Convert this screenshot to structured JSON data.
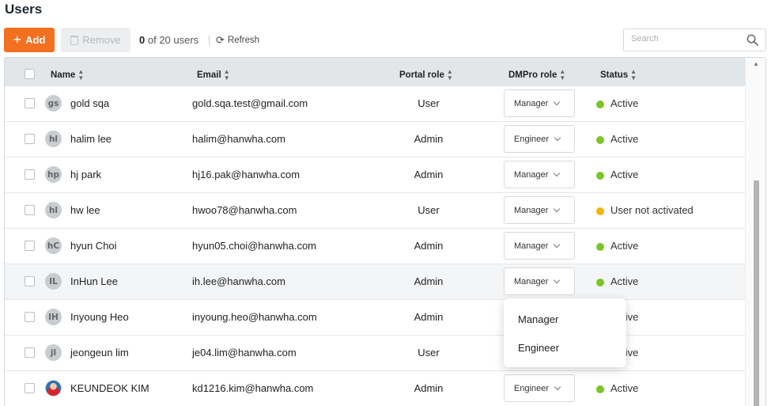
{
  "page": {
    "title": "Users"
  },
  "toolbar": {
    "add_label": "Add",
    "remove_label": "Remove",
    "count_selected": "0",
    "count_rest": "of 20 users",
    "refresh_label": "Refresh",
    "search_placeholder": "Search"
  },
  "table": {
    "headers": {
      "name": "Name",
      "email": "Email",
      "portal_role": "Portal role",
      "dmpro_role": "DMPro role",
      "status": "Status"
    },
    "rows": [
      {
        "initials": "gs",
        "name": "gold sqa",
        "email": "gold.sqa.test@gmail.com",
        "portal_role": "User",
        "dmpro_role": "Manager",
        "status": "Active"
      },
      {
        "initials": "hl",
        "name": "halim lee",
        "email": "halim@hanwha.com",
        "portal_role": "Admin",
        "dmpro_role": "Engineer",
        "status": "Active"
      },
      {
        "initials": "hp",
        "name": "hj park",
        "email": "hj16.pak@hanwha.com",
        "portal_role": "Admin",
        "dmpro_role": "Manager",
        "status": "Active"
      },
      {
        "initials": "hl",
        "name": "hw lee",
        "email": "hwoo78@hanwha.com",
        "portal_role": "User",
        "dmpro_role": "Manager",
        "status": "User not activated"
      },
      {
        "initials": "hC",
        "name": "hyun Choi",
        "email": "hyun05.choi@hanwha.com",
        "portal_role": "Admin",
        "dmpro_role": "Manager",
        "status": "Active"
      },
      {
        "initials": "IL",
        "name": "InHun Lee",
        "email": "ih.lee@hanwha.com",
        "portal_role": "Admin",
        "dmpro_role": "Manager",
        "status": "Active"
      },
      {
        "initials": "IH",
        "name": "Inyoung Heo",
        "email": "inyoung.heo@hanwha.com",
        "portal_role": "Admin",
        "dmpro_role": "",
        "status": "Active"
      },
      {
        "initials": "jl",
        "name": "jeongeun lim",
        "email": "je04.lim@hanwha.com",
        "portal_role": "User",
        "dmpro_role": "",
        "status": "Active"
      },
      {
        "initials": "",
        "name": "KEUNDEOK KIM",
        "email": "kd1216.kim@hanwha.com",
        "portal_role": "Admin",
        "dmpro_role": "Engineer",
        "status": "Active"
      }
    ]
  },
  "dropdown": {
    "options": [
      "Manager",
      "Engineer"
    ]
  },
  "colors": {
    "accent": "#f37021",
    "active": "#7cc428",
    "not_activated": "#f5b400"
  }
}
